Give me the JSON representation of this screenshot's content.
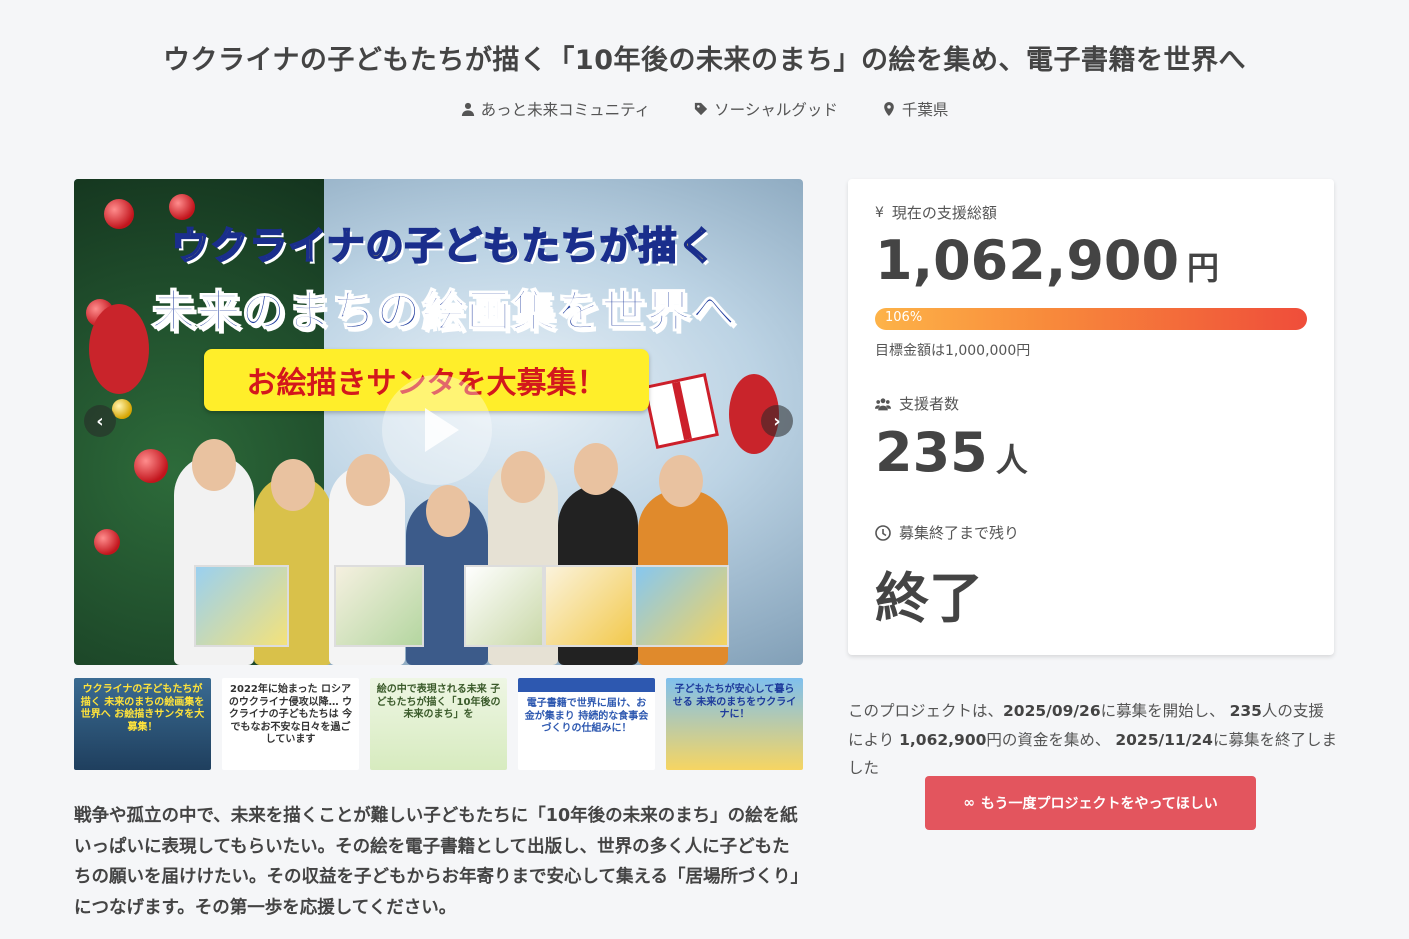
{
  "project": {
    "title": "ウクライナの子どもたちが描く「10年後の未来のまち」の絵を集め、電子書籍を世界へ",
    "owner": "あっと未来コミュニティ",
    "category": "ソーシャルグッド",
    "location": "千葉県"
  },
  "hero": {
    "line1": "ウクライナの子どもたちが描く",
    "line2": "未来のまちの絵画集を世界へ",
    "banner": "お絵描きサンタを大募集！",
    "prev": "‹",
    "next": "›"
  },
  "thumbnails": [
    {
      "text": "ウクライナの子どもたちが描く 未来のまちの絵画集を世界へ お絵描きサンタを大募集！",
      "bg": "#2f5a7d"
    },
    {
      "text": "2022年に始まった ロシアのウクライナ侵攻以降… ウクライナの子どもたちは 今でもなお不安な日々を過ごしています",
      "bg": "#ffffff"
    },
    {
      "text": "絵の中で表現される未来 子どもたちが描く「10年後の未来のまち」を",
      "bg": "#eaf2dc"
    },
    {
      "text": "電子書籍で世界に届け、お金が集まり 持続的な食事会づくりの仕組みに！",
      "bg": "#ffffff"
    },
    {
      "text": "子どもたちが安心して暮らせる 未来のまちをウクライナに！",
      "bg": "#f6d562"
    }
  ],
  "lead": "戦争や孤立の中で、未来を描くことが難しい子どもたちに「10年後の未来のまち」の絵を紙いっぱいに表現してもらいたい。その絵を電子書籍として出版し、世界の多く人に子どもたちの願いを届けけたい。その収益を子どもからお年寄りまで安心して集える「居場所づくり」につなげます。その第一歩を応援してください。",
  "stats": {
    "total_label": "現在の支援総額",
    "total_amount": "1,062,900",
    "total_unit": "円",
    "progress_text": "106%",
    "progress_value": 1.06,
    "goal_text": "目標金額は1,000,000円",
    "supporters_label": "支援者数",
    "supporters_count": "235",
    "supporters_unit": "人",
    "remaining_label": "募集終了まで残り",
    "remaining_value": "終了"
  },
  "summary": {
    "p1": "このプロジェクトは、",
    "start": "2025/09/26",
    "p2": "に募集を開始し、 ",
    "count": "235",
    "p3": "人の支援により ",
    "amount": "1,062,900",
    "p4": "円の資金を集め、 ",
    "end": "2025/11/24",
    "p5": "に募集を終了しました"
  },
  "again_button": {
    "icon": "∞",
    "label": "もう一度プロジェクトをやってほしい"
  },
  "colors": {
    "accent": "#e3555e",
    "progress_start": "#fdb348",
    "progress_end": "#ef4d3a"
  }
}
